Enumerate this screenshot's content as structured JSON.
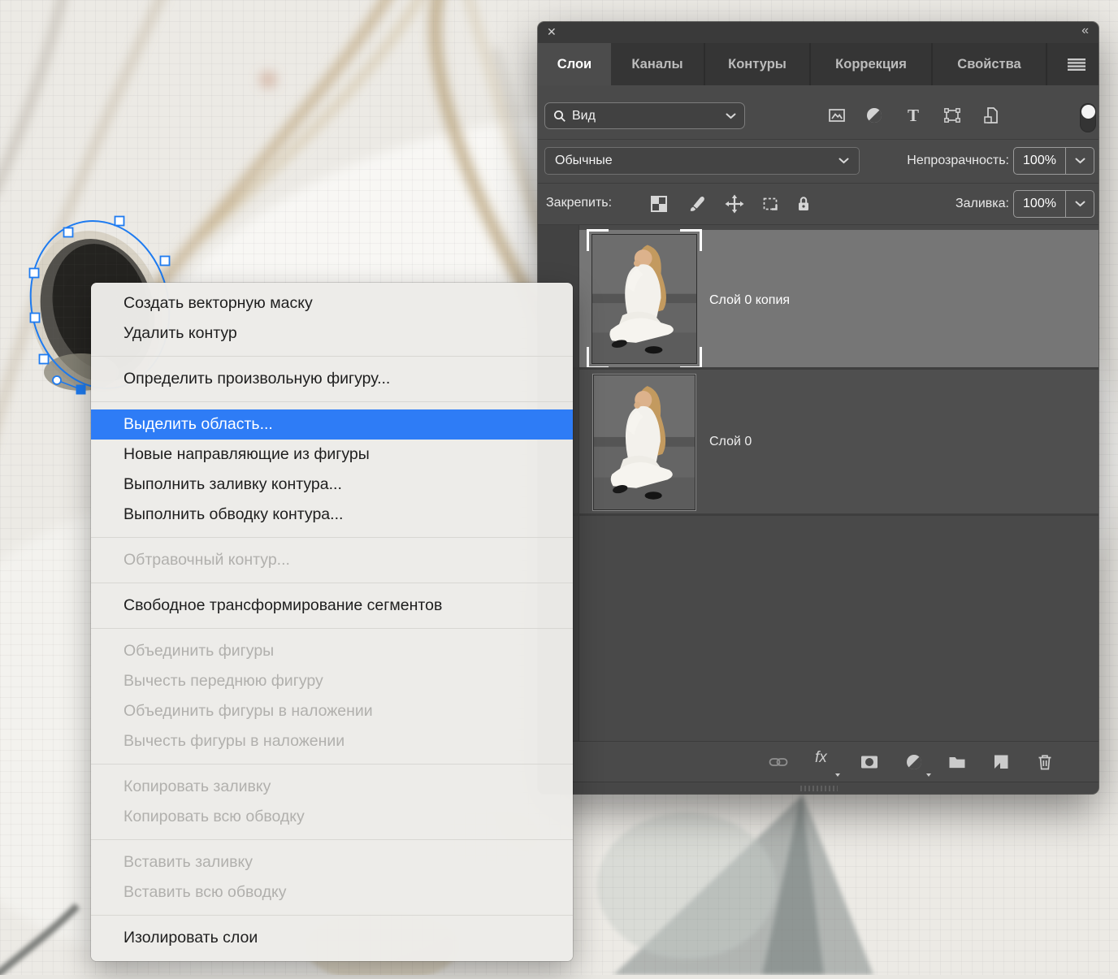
{
  "colors": {
    "accent_blue": "#2e7cf6",
    "path_blue": "#1e7bf0",
    "panel_bg": "#4a4a4a",
    "panel_chrome": "#3a3a3a",
    "selected_row": "#767676",
    "menu_bg": "#edece9"
  },
  "icons": {
    "close": "✕",
    "collapse": "«",
    "fx_label": "fx"
  },
  "panel": {
    "tabs": [
      {
        "label": "Слои",
        "active": true
      },
      {
        "label": "Каналы",
        "active": false
      },
      {
        "label": "Контуры",
        "active": false
      },
      {
        "label": "Коррекция",
        "active": false
      },
      {
        "label": "Свойства",
        "active": false
      }
    ],
    "filter_row": {
      "search_label": "Вид"
    },
    "blend_row": {
      "mode": "Обычные",
      "opacity_label": "Непрозрачность:",
      "opacity_value": "100%"
    },
    "lock_row": {
      "label": "Закрепить:",
      "fill_label": "Заливка:",
      "fill_value": "100%"
    },
    "layers": [
      {
        "name": "Слой 0 копия",
        "selected": true
      },
      {
        "name": "Слой 0",
        "selected": false
      }
    ]
  },
  "context_menu": {
    "items": [
      {
        "label": "Создать векторную маску",
        "state": "enabled"
      },
      {
        "label": "Удалить контур",
        "state": "enabled"
      },
      {
        "label": "Определить произвольную фигуру...",
        "state": "enabled"
      },
      {
        "label": "Выделить область...",
        "state": "highlighted"
      },
      {
        "label": "Новые направляющие из фигуры",
        "state": "enabled"
      },
      {
        "label": "Выполнить заливку контура...",
        "state": "enabled"
      },
      {
        "label": "Выполнить обводку контура...",
        "state": "enabled"
      },
      {
        "label": "Обтравочный контур...",
        "state": "disabled"
      },
      {
        "label": "Свободное трансформирование сегментов",
        "state": "enabled"
      },
      {
        "label": "Объединить фигуры",
        "state": "disabled"
      },
      {
        "label": "Вычесть переднюю фигуру",
        "state": "disabled"
      },
      {
        "label": "Объединить фигуры в наложении",
        "state": "disabled"
      },
      {
        "label": "Вычесть фигуры в наложении",
        "state": "disabled"
      },
      {
        "label": "Копировать заливку",
        "state": "disabled"
      },
      {
        "label": "Копировать всю обводку",
        "state": "disabled"
      },
      {
        "label": "Вставить заливку",
        "state": "disabled"
      },
      {
        "label": "Вставить всю обводку",
        "state": "disabled"
      },
      {
        "label": "Изолировать слои",
        "state": "enabled"
      }
    ]
  }
}
